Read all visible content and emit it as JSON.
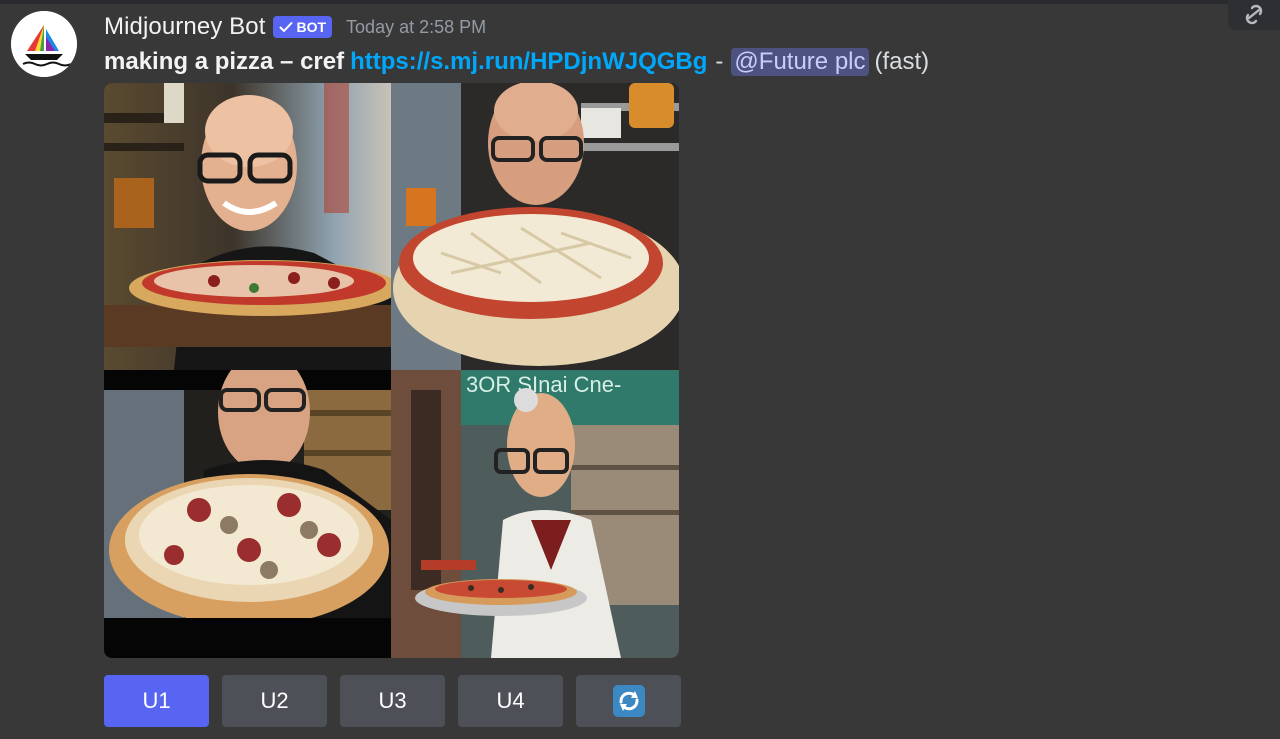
{
  "message": {
    "username": "Midjourney Bot",
    "badge": "BOT",
    "timestamp": "Today at 2:58 PM",
    "prompt": "making a pizza – cref",
    "link": "https://s.mj.run/HPDjnWJQGBg",
    "separator": "-",
    "mention": "@Future plc",
    "speed": "(fast)"
  },
  "images": {
    "tiles": [
      {
        "name": "pizza-image-1"
      },
      {
        "name": "pizza-image-2"
      },
      {
        "name": "pizza-image-3"
      },
      {
        "name": "pizza-image-4",
        "sign_text": "3OR SInai Cne-"
      }
    ]
  },
  "buttons": {
    "u1": "U1",
    "u2": "U2",
    "u3": "U3",
    "u4": "U4",
    "reroll_icon": "refresh-icon"
  },
  "colors": {
    "blurple": "#5865f2",
    "link": "#00a8fc",
    "background": "#383838",
    "button": "#4e5058"
  }
}
